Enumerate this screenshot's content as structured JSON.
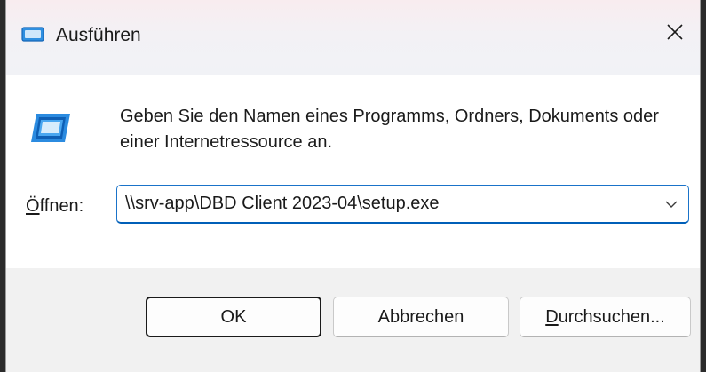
{
  "window": {
    "title": "Ausführen",
    "accent_color": "#005fb8",
    "icon": "run-dialog-icon"
  },
  "content": {
    "description": "Geben Sie den Namen eines Programms, Ordners, Dokuments oder einer Internetressource an.",
    "open_label_accesskey": "Ö",
    "open_label_rest": "ffnen:",
    "open_value": "\\\\srv-app\\DBD Client 2023-04\\setup.exe"
  },
  "buttons": {
    "ok": "OK",
    "cancel": "Abbrechen",
    "browse_accesskey": "D",
    "browse_rest": "urchsuchen..."
  }
}
